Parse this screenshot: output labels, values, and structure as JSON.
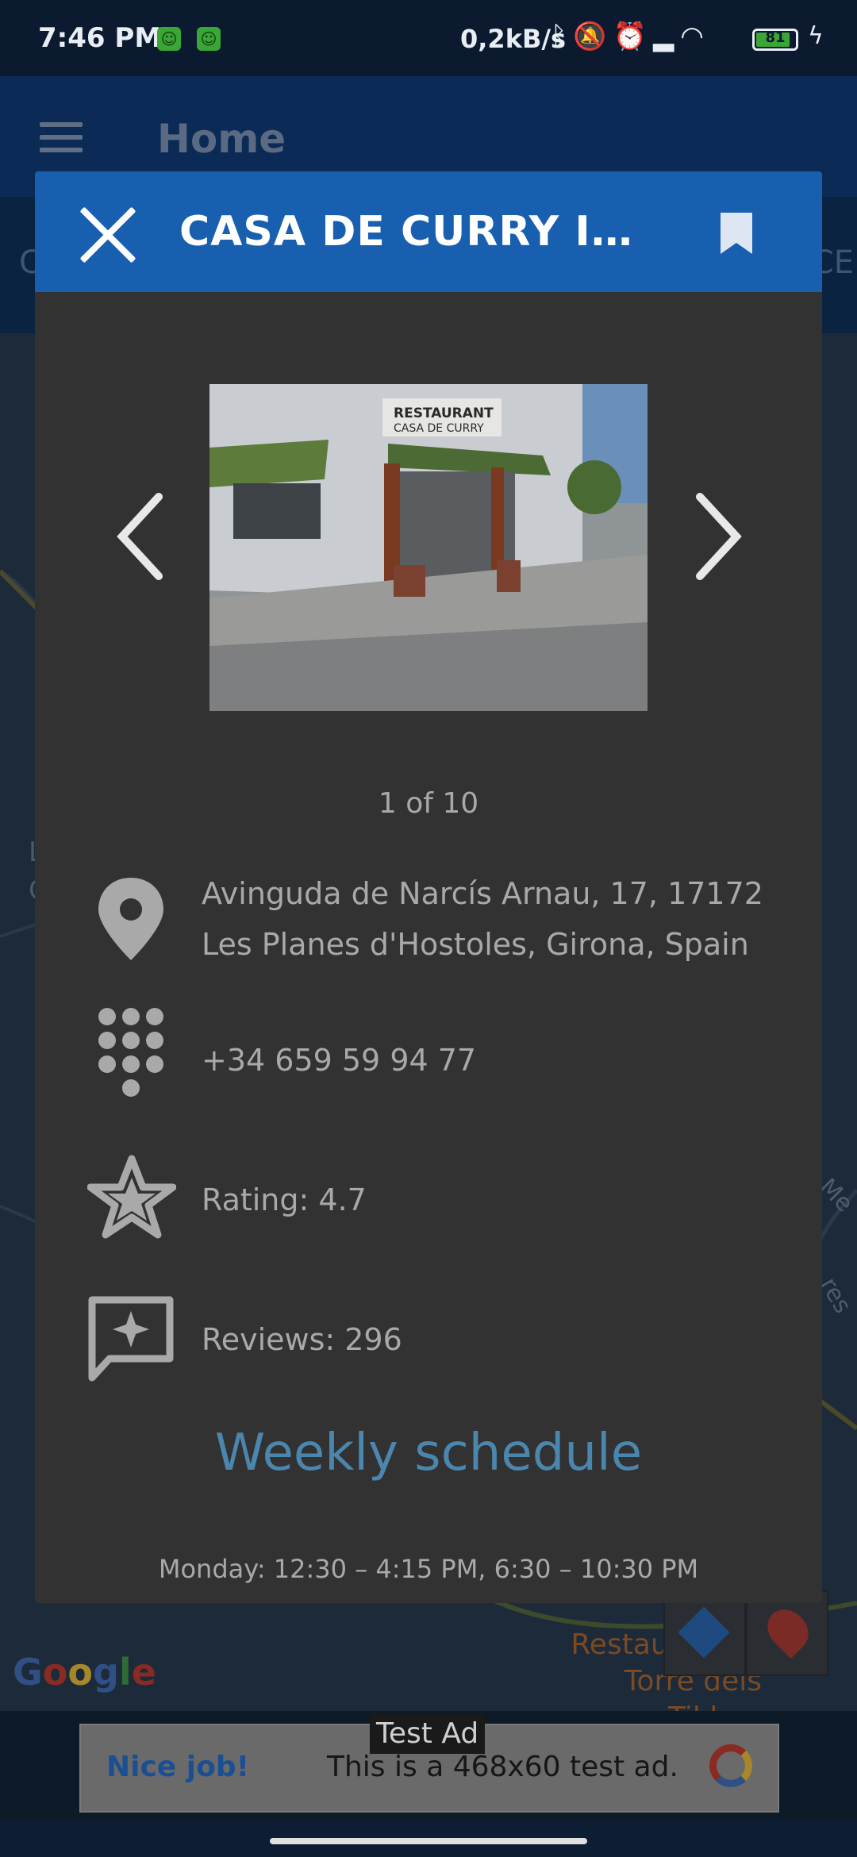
{
  "status_bar": {
    "time": "7:46 PM",
    "network_speed": "0,2kB/s",
    "battery_level": "81",
    "battery_percent": 81,
    "icons": [
      "bluetooth-icon",
      "mute-icon",
      "alarm-icon",
      "signal-icon",
      "wifi-icon",
      "charging-icon"
    ]
  },
  "app_bar": {
    "title": "Home",
    "menu_icon": "hamburger-icon"
  },
  "tabs": {
    "left_fragment": "C",
    "right_fragment": "CE"
  },
  "map": {
    "left_label_fragments": [
      "L",
      "C"
    ],
    "side_fragment_1": "s Me",
    "side_fragment_2": "res",
    "poi_label_line1": "Restaurant la",
    "poi_label_line2": "Torre dels Til·lers",
    "google_logo": [
      "G",
      "o",
      "o",
      "g",
      "l",
      "e"
    ]
  },
  "dialog": {
    "title": "CASA DE CURRY INDIAN RESTAURANT",
    "bookmark_icon": "bookmark-icon",
    "close_icon": "close-icon",
    "photo": {
      "sign_line1": "RESTAURANT",
      "sign_line2": "CASA DE CURRY",
      "counter": "1 of 10"
    },
    "address_line1": "Avinguda de Narcís Arnau, 17, 17172",
    "address_line2": "Les Planes d'Hostoles, Girona, Spain",
    "phone": "+34 659 59 94 77",
    "rating": "Rating: 4.7",
    "reviews": "Reviews: 296",
    "schedule_title": "Weekly schedule",
    "schedule_monday": "Monday: 12:30 – 4:15 PM, 6:30 – 10:30 PM"
  },
  "ad": {
    "tag": "Test Ad",
    "headline": "Nice job!",
    "body": "This is a 468x60 test ad."
  },
  "colors": {
    "dialog_header": "#185fb0",
    "dialog_body": "#323232",
    "schedule_title": "#4a86ad",
    "text_muted": "#a9a9a9"
  }
}
